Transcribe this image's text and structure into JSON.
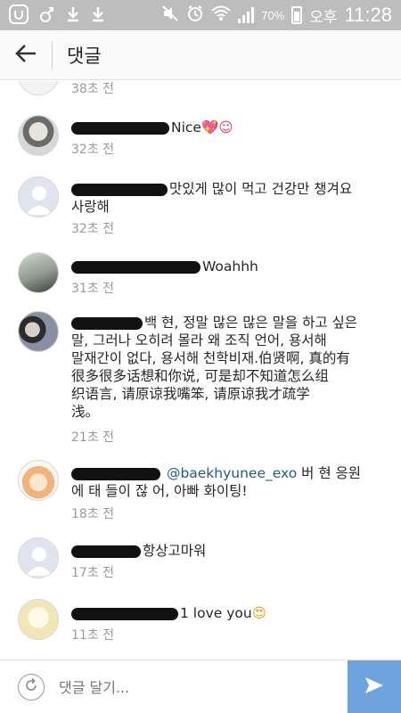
{
  "status_bar": {
    "battery_percent": "70%",
    "ampm": "오후",
    "time": "11:28",
    "icons": [
      "u-app-icon",
      "running-icon",
      "download-icon",
      "download-icon",
      "mute-icon",
      "alarm-icon",
      "wifi-icon",
      "signal-icon"
    ]
  },
  "header": {
    "title": "댓글",
    "back_icon": "arrow-left-icon"
  },
  "comments": [
    {
      "text": "",
      "time": "38초 전"
    },
    {
      "text": "Nice",
      "emoji": "💖☺",
      "time": "32초 전"
    },
    {
      "text": "맛있게 많이 먹고 건강만 챙겨요",
      "text2": "사랑해",
      "time": "32초 전"
    },
    {
      "text": "Woahhh",
      "time": "31초 전"
    },
    {
      "line1": "백 현, 정말 많은 많은 말을 하고 싶은",
      "line2": "말, 그러나 오히려 몰라 왜 조직 언어, 용서해",
      "line3": "말재간이 없다, 용서해 천학비재.伯贤啊,  真的有",
      "line4": "很多很多话想和你说,  可是却不知道怎么组",
      "line5": "织语言,  请原谅我嘴笨,  请原谅我才疏学",
      "line6": "浅。",
      "time": "21초 전"
    },
    {
      "mention": "@baekhyunee_exo",
      "text": "버 현 응원",
      "text2": "에 태 들이 잖 어, 아빠 화이팅!",
      "time": "18초 전"
    },
    {
      "text": "항상고마워",
      "time": "17초 전"
    },
    {
      "text": "1 love you",
      "emoji": "😍",
      "time": "11초 전"
    }
  ],
  "input": {
    "placeholder": "댓글 달기...",
    "refresh_icon": "refresh-icon",
    "send_icon": "send-icon"
  },
  "colors": {
    "status_bar": "#bdbdbd",
    "send_button": "#6ea4dd",
    "mention": "#1f5b8e",
    "timestamp": "#9a9a9a"
  }
}
